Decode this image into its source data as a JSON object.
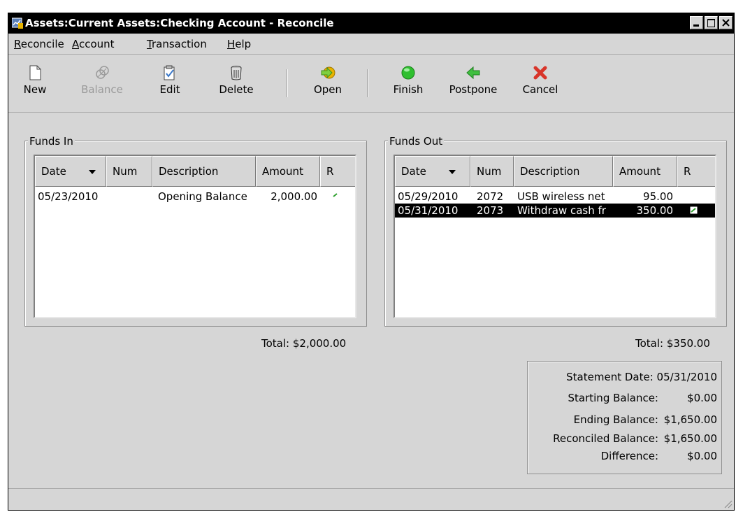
{
  "window": {
    "title": "Assets:Current Assets:Checking Account - Reconcile"
  },
  "menu": [
    {
      "label": "Reconcile",
      "mnemonic": "R",
      "rest": "econcile"
    },
    {
      "label": "Account",
      "mnemonic": "A",
      "rest": "ccount"
    },
    {
      "label": "Transaction",
      "mnemonic": "T",
      "rest": "ransaction"
    },
    {
      "label": "Help",
      "mnemonic": "H",
      "rest": "elp"
    }
  ],
  "toolbar": {
    "new": "New",
    "balance": "Balance",
    "edit": "Edit",
    "delete": "Delete",
    "open": "Open",
    "finish": "Finish",
    "postpone": "Postpone",
    "cancel": "Cancel"
  },
  "funds_in": {
    "title": "Funds In",
    "headers": {
      "date": "Date",
      "num": "Num",
      "description": "Description",
      "amount": "Amount",
      "r": "R"
    },
    "rows": [
      {
        "date": "05/23/2010",
        "num": "",
        "description": "Opening Balance",
        "amount": "2,000.00",
        "reconciled": true
      }
    ],
    "total": "Total: $2,000.00"
  },
  "funds_out": {
    "title": "Funds Out",
    "headers": {
      "date": "Date",
      "num": "Num",
      "description": "Description",
      "amount": "Amount",
      "r": "R"
    },
    "rows": [
      {
        "date": "05/29/2010",
        "num": "2072",
        "description": "USB wireless net",
        "amount": "95.00",
        "reconciled": false
      },
      {
        "date": "05/31/2010",
        "num": "2073",
        "description": "Withdraw cash fr",
        "amount": "350.00",
        "reconciled": true
      }
    ],
    "total": "Total: $350.00"
  },
  "summary": {
    "statement_date": "Statement Date: 05/31/2010",
    "starting_label": "Starting Balance:",
    "starting_value": "$0.00",
    "ending_label": "Ending Balance:",
    "ending_value": "$1,650.00",
    "reconciled_label": "Reconciled Balance:",
    "reconciled_value": "$1,650.00",
    "difference_label": "Difference:",
    "difference_value": "$0.00"
  },
  "colors": {
    "selection": "#000000",
    "finish": "#2fbf2f",
    "postpone": "#3fbf3f",
    "cancel": "#d8352a",
    "open": "#e8b400"
  }
}
